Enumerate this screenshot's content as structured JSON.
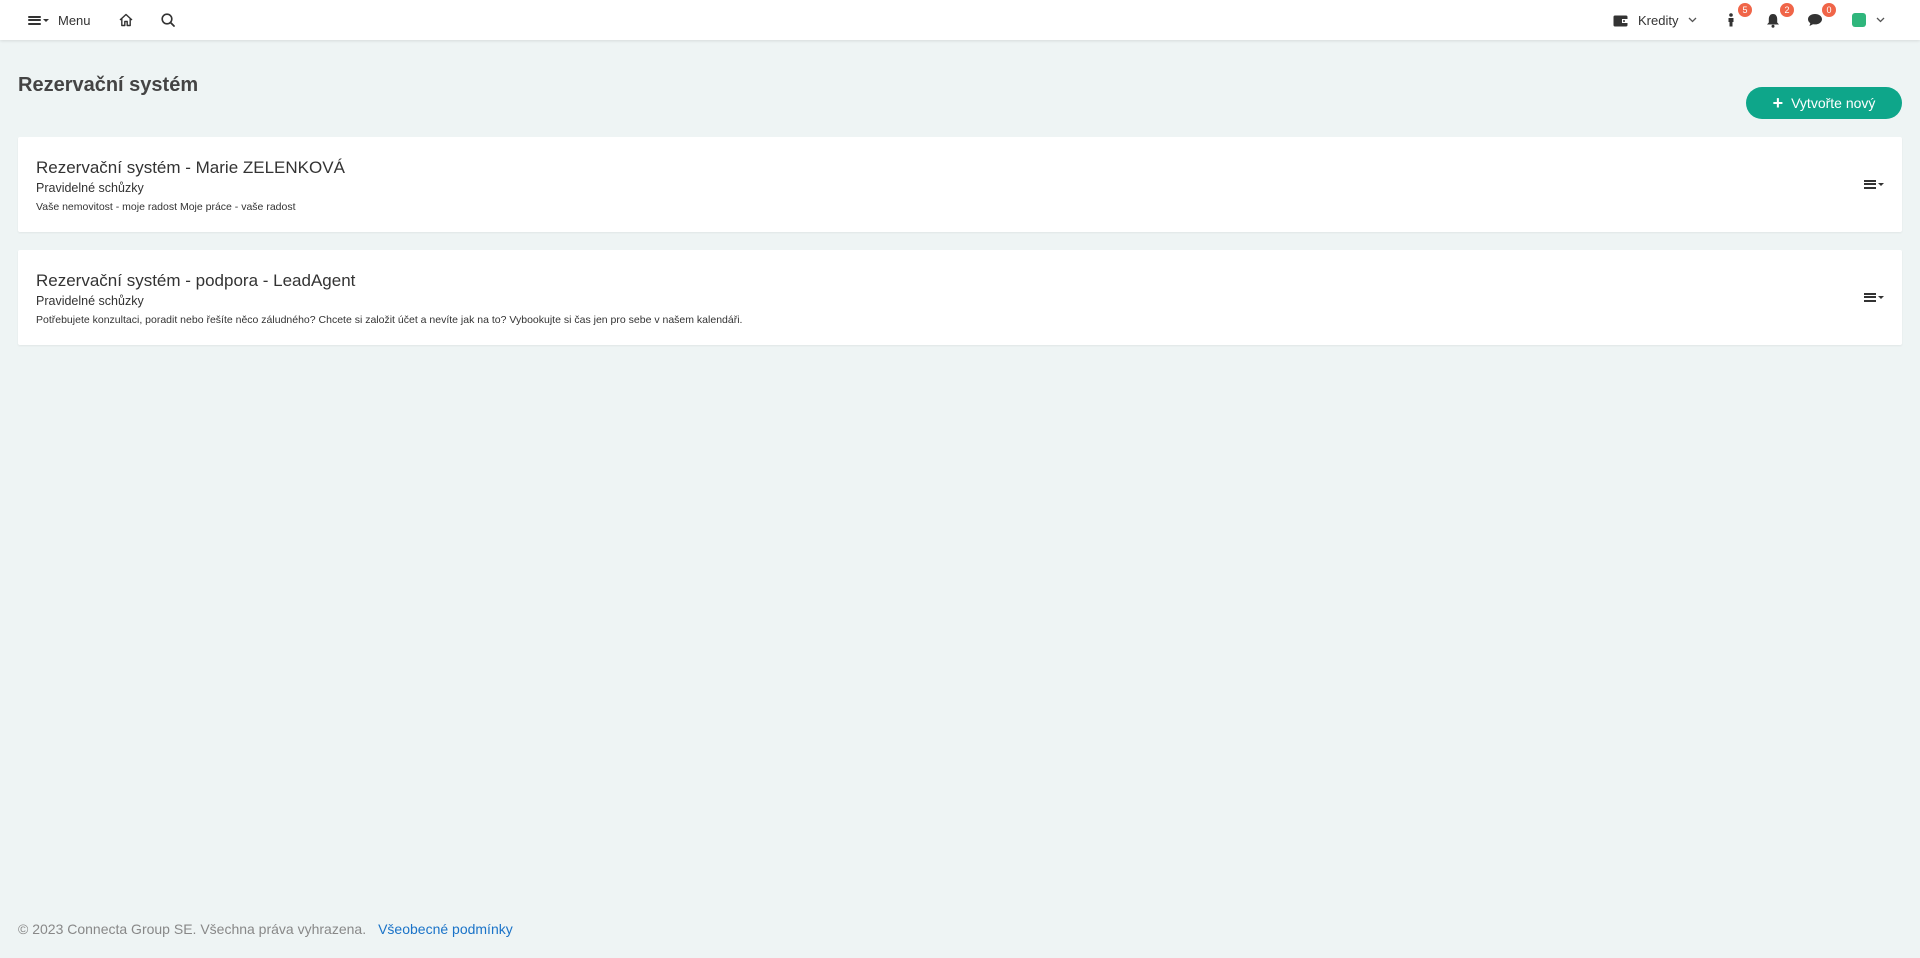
{
  "topbar": {
    "menu_label": "Menu",
    "kredity_label": "Kredity",
    "badges": {
      "person": "5",
      "notifications": "2",
      "messages": "0"
    }
  },
  "page": {
    "title": "Rezervační systém",
    "create_button": "Vytvořte nový"
  },
  "cards": [
    {
      "title": "Rezervační systém - Marie ZELENKOVÁ",
      "subtitle": "Pravidelné schůzky",
      "description": "Vaše nemovitost - moje radost Moje práce - vaše radost"
    },
    {
      "title": "Rezervační systém - podpora - LeadAgent",
      "subtitle": "Pravidelné schůzky",
      "description": "Potřebujete konzultaci, poradit nebo řešíte něco záludného? Chcete si založit účet a nevíte jak na to? Vybookujte si čas jen pro sebe v našem kalendáři."
    }
  ],
  "footer": {
    "copyright": "© 2023 Connecta Group SE. Všechna práva vyhrazena.",
    "terms_link": "Všeobecné podmínky"
  },
  "colors": {
    "accent": "#0ea68a",
    "badge": "#f06548",
    "link": "#1a73c8",
    "background": "#eef4f4"
  }
}
